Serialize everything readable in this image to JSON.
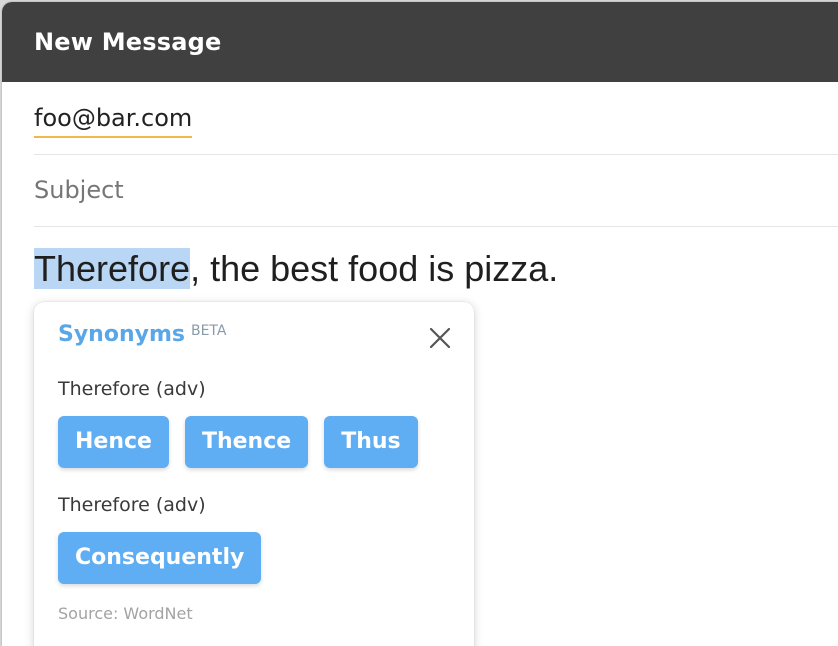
{
  "window": {
    "title": "New Message"
  },
  "recipient": {
    "to": "foo@bar.com"
  },
  "subject": {
    "placeholder": "Subject",
    "value": ""
  },
  "body": {
    "selected_word": "Therefore",
    "rest": ", the best food is pizza."
  },
  "synonyms_popup": {
    "title": "Synonyms",
    "badge": "BETA",
    "close_icon": "close-icon",
    "groups": [
      {
        "label": "Therefore (adv)",
        "words": [
          "Hence",
          "Thence",
          "Thus"
        ]
      },
      {
        "label": "Therefore (adv)",
        "words": [
          "Consequently"
        ]
      }
    ],
    "source": "Source: WordNet"
  },
  "colors": {
    "titlebar": "#404040",
    "accent": "#5fadf3",
    "popup_title": "#5aa7e8",
    "selection": "#b9d7f5",
    "recipient_underline": "#f2b84b"
  }
}
